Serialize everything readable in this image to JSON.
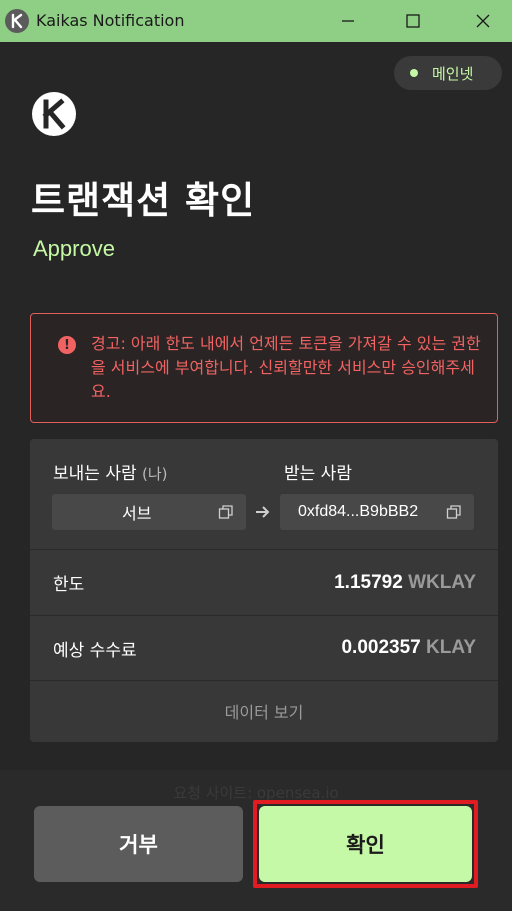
{
  "window": {
    "title": "Kaikas Notification",
    "minimize": "—",
    "maximize": "☐",
    "close": "✕"
  },
  "network": {
    "label": "메인넷",
    "dot_color": "#c5f8a5"
  },
  "header": {
    "title": "트랜잭션 확인",
    "subtitle": "Approve"
  },
  "warning": {
    "icon": "!",
    "text": "경고: 아래 한도 내에서 언제든 토큰을 가져갈 수 있는 권한을 서비스에 부여합니다. 신뢰할만한 서비스만 승인해주세요."
  },
  "transfer": {
    "sender_label": "보내는 사람",
    "sender_tag": "(나)",
    "receiver_label": "받는 사람",
    "from": "서브",
    "to": "0xfd84...B9bBB2"
  },
  "details": {
    "limit_label": "한도",
    "limit_value": "1.15792",
    "limit_unit": "WKLAY",
    "fee_label": "예상 수수료",
    "fee_value": "0.002357",
    "fee_unit": "KLAY",
    "view_data": "데이터 보기"
  },
  "origin": "요청 사이트: opensea.io",
  "buttons": {
    "reject": "거부",
    "confirm": "확인"
  },
  "colors": {
    "accent": "#c5f8a5",
    "warning": "#f06362",
    "highlight": "#e11b22"
  }
}
